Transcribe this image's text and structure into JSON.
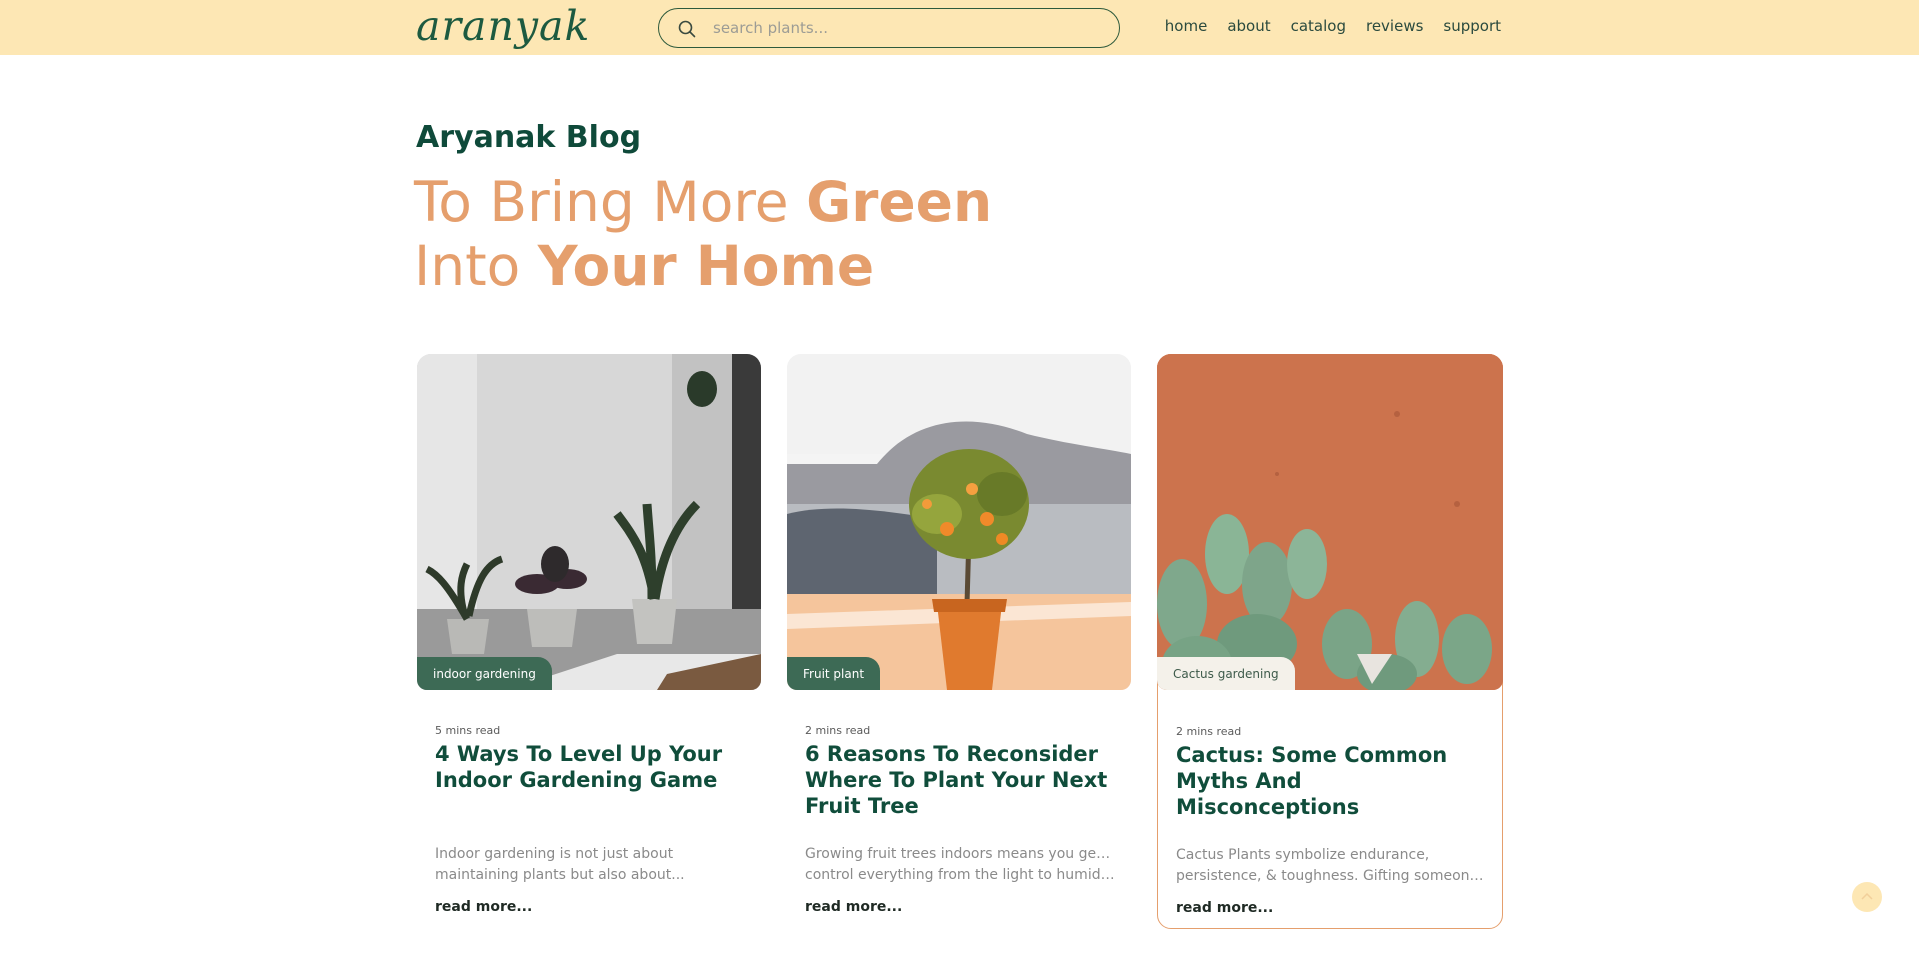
{
  "header": {
    "logo_text": "aranyak",
    "search_placeholder": "search plants...",
    "nav": [
      "home",
      "about",
      "catalog",
      "reviews",
      "support"
    ]
  },
  "hero": {
    "blog_title": "Aryanak Blog",
    "line1_light": "To Bring More ",
    "line1_bold": "Green",
    "line2_light": "Into ",
    "line2_bold": "Your Home"
  },
  "cards": [
    {
      "tag": "indoor gardening",
      "read_time": "5 mins read",
      "title": "4 Ways To Level Up Your Indoor Gardening Game",
      "excerpt_line1": "Indoor gardening is not just about",
      "excerpt_line2": "maintaining plants but also about...",
      "read_more": "read more..."
    },
    {
      "tag": "Fruit plant",
      "read_time": "2 mins read",
      "title": "6 Reasons To Reconsider Where To Plant Your Next Fruit Tree",
      "excerpt_line1": "Growing fruit trees indoors means you get to",
      "excerpt_line2": "control everything from the light to humidity...",
      "read_more": "read more..."
    },
    {
      "tag": "Cactus gardening",
      "read_time": "2 mins read",
      "title": "Cactus: Some Common Myths And Misconceptions",
      "excerpt_line1": "Cactus Plants symbolize endurance,",
      "excerpt_line2": "persistence, & toughness. Gifting someone ...",
      "read_more": "read more..."
    }
  ],
  "colors": {
    "header_bg": "#fde7b4",
    "brand_green": "#0f4a3a",
    "accent_peach": "#e59f6d",
    "tag_green": "#3d6a55",
    "tag_light": "#f4f1ea"
  },
  "icons": {
    "search": "search-icon",
    "scroll_top": "chevron-up-icon"
  }
}
